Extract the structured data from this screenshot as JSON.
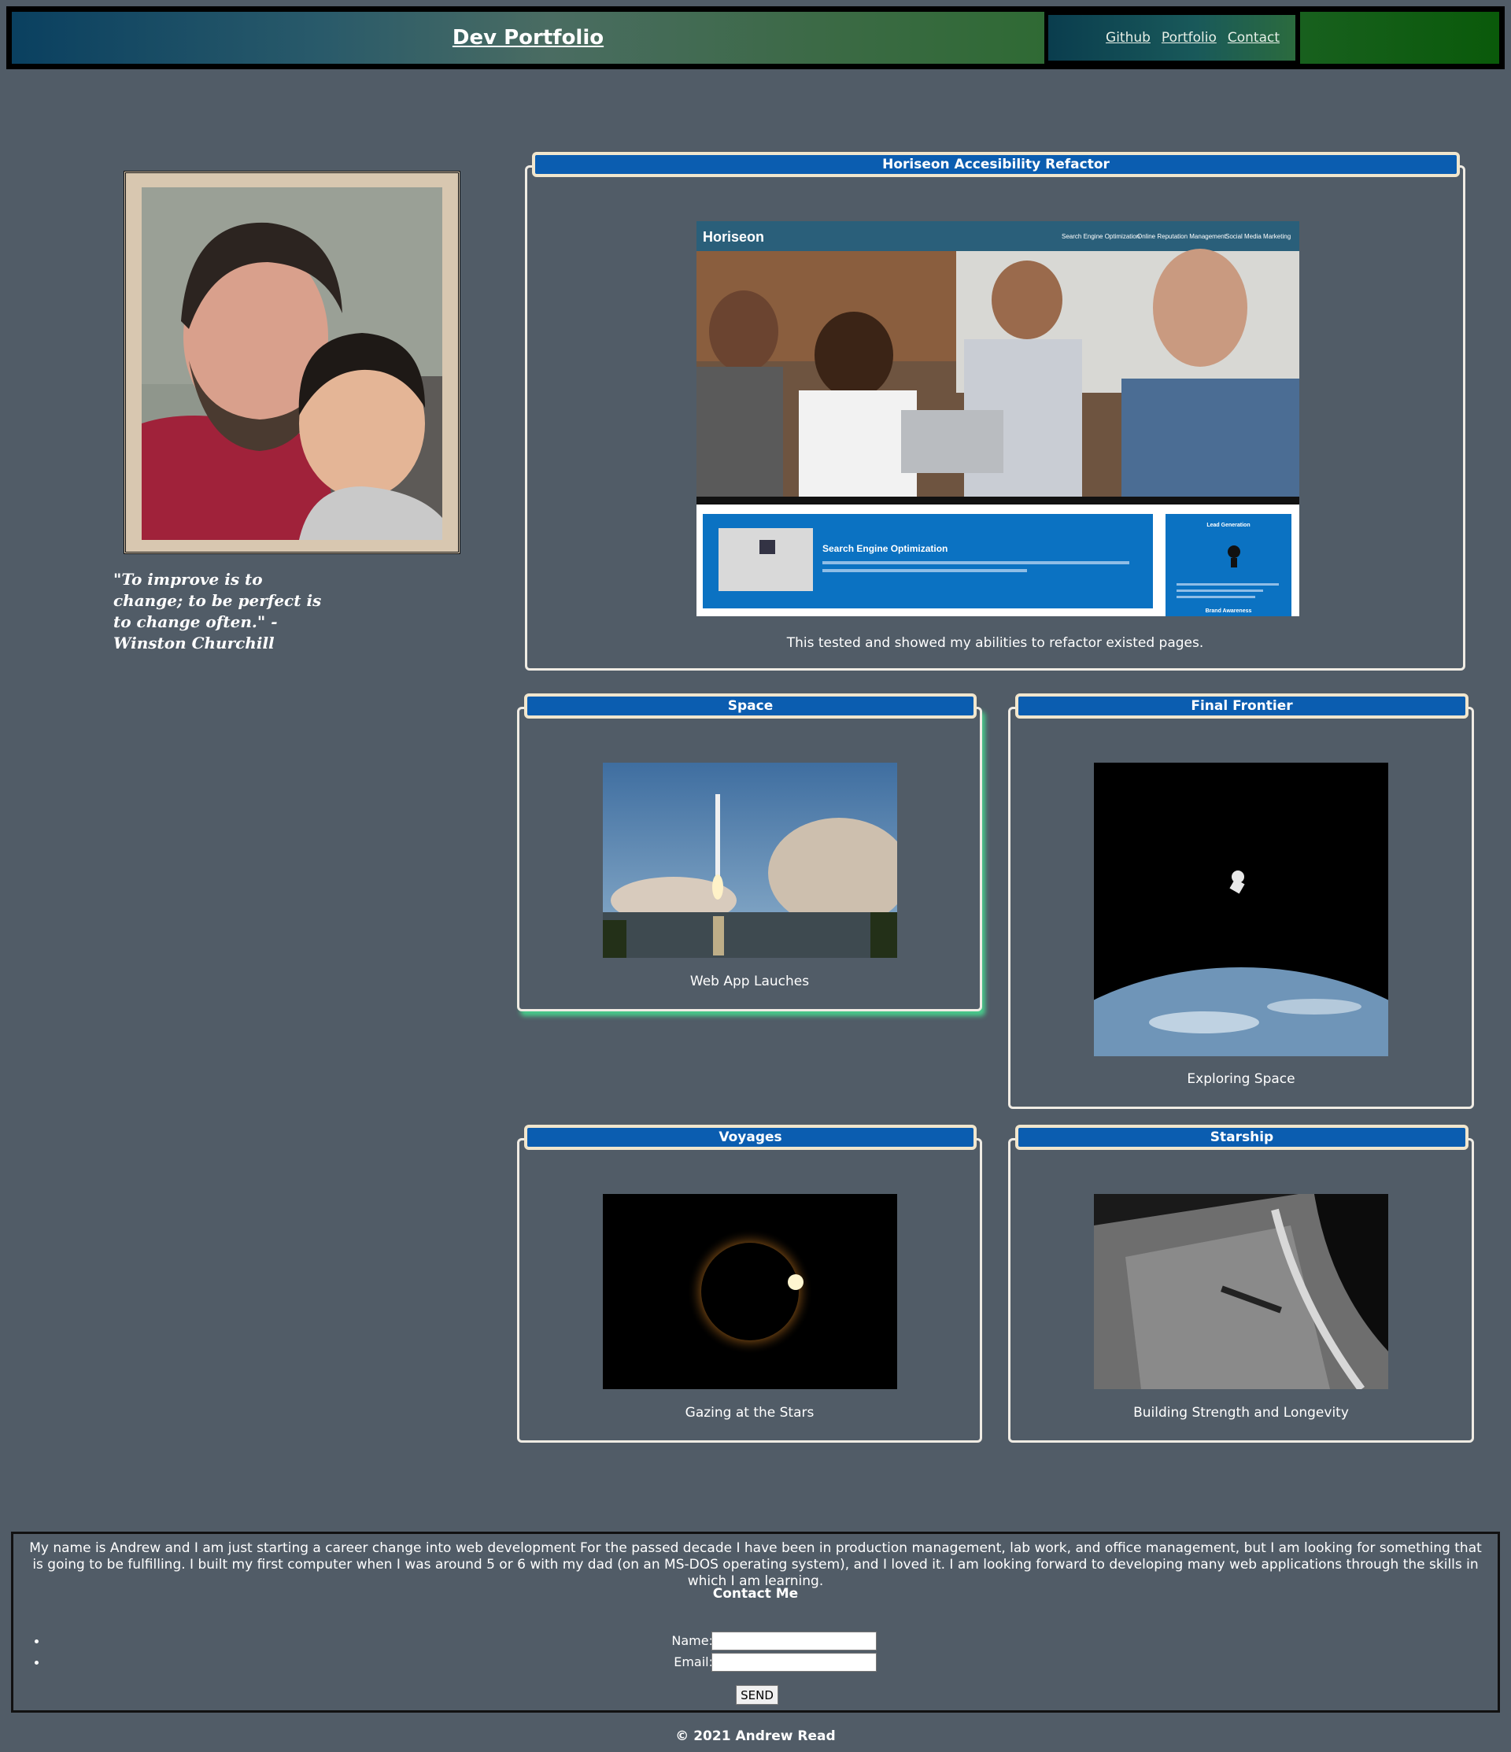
{
  "header": {
    "brand": "Dev Portfolio",
    "nav": [
      {
        "label": "Github"
      },
      {
        "label": "Portfolio"
      },
      {
        "label": "Contact"
      }
    ]
  },
  "profile": {
    "quote": "\"To improve is to change; to be perfect is to change often.\" -Winston Churchill"
  },
  "projects": [
    {
      "title": "Horiseon Accesibility Refactor",
      "caption": "This tested and showed my abilities to refactor existed pages."
    },
    {
      "title": "Space",
      "caption": "Web App Lauches"
    },
    {
      "title": "Final Frontier",
      "caption": "Exploring Space"
    },
    {
      "title": "Voyages",
      "caption": "Gazing at the Stars"
    },
    {
      "title": "Starship",
      "caption": "Building Strength and Longevity"
    }
  ],
  "horiseon_screenshot": {
    "logo": "Horiseon",
    "nav": [
      "Search Engine Optimization",
      "Online Reputation Management",
      "Social Media Marketing"
    ],
    "section_title": "Search Engine Optimization",
    "side_title": "Lead Generation",
    "side_footer": "Brand Awareness"
  },
  "about": {
    "text": "My name is Andrew and I am just starting a career change into web development For the passed decade I have been in production management, lab work, and office management, but I am looking for something that is going to be fulfilling. I built my first computer when I was around 5 or 6 with my dad (on an MS-DOS operating system), and I loved it. I am looking forward to developing many web applications through the skills in which I am learning.",
    "contact_title": "Contact Me",
    "name_label": "Name:",
    "email_label": "Email:",
    "name_value": "",
    "email_value": "",
    "send_label": "SEND"
  },
  "footer": {
    "text": "© 2021 Andrew Read"
  },
  "colors": {
    "background": "#515c67",
    "card_title": "#0b5db0",
    "card_title_border": "#f1e6cd",
    "glow": "#49c98b"
  }
}
